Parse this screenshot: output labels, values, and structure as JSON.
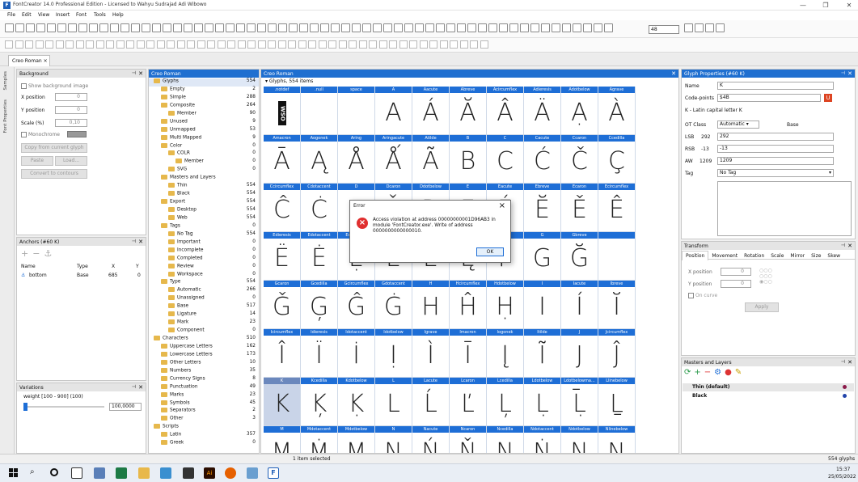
{
  "window": {
    "title": "FontCreator 14.0 Professional Edition - Licensed to Wahyu Sudrajad Adi Wibowo",
    "controls": [
      "—",
      "❐",
      "✕"
    ]
  },
  "menu": [
    "File",
    "Edit",
    "View",
    "Insert",
    "Font",
    "Tools",
    "Help"
  ],
  "toolbar": {
    "zoom_value": "48"
  },
  "doc_tab": "Creo Roman",
  "side_tabs": [
    "Samples",
    "Font Properties"
  ],
  "background_panel": {
    "title": "Background",
    "show_image_label": "Show background image",
    "x_label": "X position",
    "x_value": "0",
    "y_label": "Y position",
    "y_value": "0",
    "scale_label": "Scale (%)",
    "scale_value": "0,10",
    "mono_label": "Monochrome",
    "copy_btn": "Copy from current glyph",
    "paste_btn": "Paste",
    "load_btn": "Load...",
    "convert_btn": "Convert to contours"
  },
  "anchors_panel": {
    "title": "Anchors (#60 K)",
    "cols": [
      "Name",
      "Type",
      "X",
      "Y"
    ],
    "rows": [
      {
        "name": "bottom",
        "type": "Base",
        "x": "685",
        "y": "0"
      }
    ]
  },
  "variations_panel": {
    "title": "Variations",
    "weight_label": "weight [100 - 900] (100)",
    "weight_value": "100,0000"
  },
  "glyph_tree_panel": {
    "title": "Creo Roman",
    "rows": [
      {
        "indent": 0,
        "label": "Glyphs",
        "count": "554",
        "sel": true
      },
      {
        "indent": 1,
        "label": "Empty",
        "count": "2"
      },
      {
        "indent": 1,
        "label": "Simple",
        "count": "288"
      },
      {
        "indent": 1,
        "label": "Composite",
        "count": "264"
      },
      {
        "indent": 2,
        "label": "Member",
        "count": "90"
      },
      {
        "indent": 1,
        "label": "Unused",
        "count": "9"
      },
      {
        "indent": 1,
        "label": "Unmapped",
        "count": "53"
      },
      {
        "indent": 1,
        "label": "Multi Mapped",
        "count": "9"
      },
      {
        "indent": 1,
        "label": "Color",
        "count": "0"
      },
      {
        "indent": 2,
        "label": "COLR",
        "count": "0"
      },
      {
        "indent": 3,
        "label": "Member",
        "count": "0"
      },
      {
        "indent": 2,
        "label": "SVG",
        "count": "0"
      },
      {
        "indent": 1,
        "label": "Masters and Layers",
        "count": ""
      },
      {
        "indent": 2,
        "label": "Thin",
        "count": "554"
      },
      {
        "indent": 2,
        "label": "Black",
        "count": "554"
      },
      {
        "indent": 1,
        "label": "Export",
        "count": "554"
      },
      {
        "indent": 2,
        "label": "Desktop",
        "count": "554"
      },
      {
        "indent": 2,
        "label": "Web",
        "count": "554"
      },
      {
        "indent": 1,
        "label": "Tags",
        "count": "0"
      },
      {
        "indent": 2,
        "label": "No Tag",
        "count": "554"
      },
      {
        "indent": 2,
        "label": "Important",
        "count": "0"
      },
      {
        "indent": 2,
        "label": "Incomplete",
        "count": "0"
      },
      {
        "indent": 2,
        "label": "Completed",
        "count": "0"
      },
      {
        "indent": 2,
        "label": "Review",
        "count": "0"
      },
      {
        "indent": 2,
        "label": "Workspace",
        "count": "0"
      },
      {
        "indent": 1,
        "label": "Type",
        "count": "554"
      },
      {
        "indent": 2,
        "label": "Automatic",
        "count": "266"
      },
      {
        "indent": 2,
        "label": "Unassigned",
        "count": "0"
      },
      {
        "indent": 2,
        "label": "Base",
        "count": "517"
      },
      {
        "indent": 2,
        "label": "Ligature",
        "count": "14"
      },
      {
        "indent": 2,
        "label": "Mark",
        "count": "23"
      },
      {
        "indent": 2,
        "label": "Component",
        "count": "0"
      },
      {
        "indent": 0,
        "label": "Characters",
        "count": "510"
      },
      {
        "indent": 1,
        "label": "Uppercase Letters",
        "count": "162"
      },
      {
        "indent": 1,
        "label": "Lowercase Letters",
        "count": "173"
      },
      {
        "indent": 1,
        "label": "Other Letters",
        "count": "10"
      },
      {
        "indent": 1,
        "label": "Numbers",
        "count": "35"
      },
      {
        "indent": 1,
        "label": "Currency Signs",
        "count": "8"
      },
      {
        "indent": 1,
        "label": "Punctuation",
        "count": "49"
      },
      {
        "indent": 1,
        "label": "Marks",
        "count": "23"
      },
      {
        "indent": 1,
        "label": "Symbols",
        "count": "45"
      },
      {
        "indent": 1,
        "label": "Separators",
        "count": "2"
      },
      {
        "indent": 1,
        "label": "Other",
        "count": "3"
      },
      {
        "indent": 0,
        "label": "Scripts",
        "count": ""
      },
      {
        "indent": 1,
        "label": "Latin",
        "count": "357"
      },
      {
        "indent": 1,
        "label": "Greek",
        "count": "0"
      }
    ]
  },
  "glyph_grid": {
    "header": "Glyphs, 554 items",
    "rows": [
      [
        {
          "n": ".notdef",
          "g": "WSO"
        },
        {
          "n": ".null",
          "g": ""
        },
        {
          "n": "space",
          "g": ""
        },
        {
          "n": "A",
          "g": "A"
        },
        {
          "n": "Aacute",
          "g": "Á"
        },
        {
          "n": "Abreve",
          "g": "Ă"
        },
        {
          "n": "Acircumflex",
          "g": "Â"
        },
        {
          "n": "Adieresis",
          "g": "Ä"
        },
        {
          "n": "Adotbelow",
          "g": "Ạ"
        },
        {
          "n": "Agrave",
          "g": "À"
        }
      ],
      [
        {
          "n": "Amacron",
          "g": "Ā"
        },
        {
          "n": "Aogonek",
          "g": "Ą"
        },
        {
          "n": "Aring",
          "g": "Å"
        },
        {
          "n": "Aringacute",
          "g": "Ǻ"
        },
        {
          "n": "Atilde",
          "g": "Ã"
        },
        {
          "n": "B",
          "g": "B"
        },
        {
          "n": "C",
          "g": "C"
        },
        {
          "n": "Cacute",
          "g": "Ć"
        },
        {
          "n": "Ccaron",
          "g": "Č"
        },
        {
          "n": "Ccedilla",
          "g": "Ç"
        }
      ],
      [
        {
          "n": "Ccircumflex",
          "g": "Ĉ"
        },
        {
          "n": "Cdotaccent",
          "g": "Ċ"
        },
        {
          "n": "D",
          "g": "D"
        },
        {
          "n": "Dcaron",
          "g": "Ď"
        },
        {
          "n": "Ddotbelow",
          "g": "Ḍ"
        },
        {
          "n": "E",
          "g": "E"
        },
        {
          "n": "Eacute",
          "g": "É"
        },
        {
          "n": "Ebreve",
          "g": "Ĕ"
        },
        {
          "n": "Ecaron",
          "g": "Ě"
        },
        {
          "n": "Ecircumflex",
          "g": "Ê"
        }
      ],
      [
        {
          "n": "Edieresis",
          "g": "Ë"
        },
        {
          "n": "Edotaccent",
          "g": "Ė"
        },
        {
          "n": "Edotbelow",
          "g": "Ẹ"
        },
        {
          "n": "Egrave",
          "g": "È"
        },
        {
          "n": "Emacron",
          "g": "Ē"
        },
        {
          "n": "Eogonek",
          "g": "Ę"
        },
        {
          "n": "F",
          "g": "F"
        },
        {
          "n": "G",
          "g": "G"
        },
        {
          "n": "Gbreve",
          "g": "Ğ"
        },
        {
          "n": "",
          "g": ""
        }
      ],
      [
        {
          "n": "Gcaron",
          "g": "Ǧ"
        },
        {
          "n": "Gcedilla",
          "g": "Ģ"
        },
        {
          "n": "Gcircumflex",
          "g": "Ĝ"
        },
        {
          "n": "Gdotaccent",
          "g": "Ġ"
        },
        {
          "n": "H",
          "g": "H"
        },
        {
          "n": "Hcircumflex",
          "g": "Ĥ"
        },
        {
          "n": "Hdotbelow",
          "g": "Ḥ"
        },
        {
          "n": "I",
          "g": "I"
        },
        {
          "n": "Iacute",
          "g": "Í"
        },
        {
          "n": "Ibreve",
          "g": "Ĭ"
        }
      ],
      [
        {
          "n": "Icircumflex",
          "g": "Î"
        },
        {
          "n": "Idieresis",
          "g": "Ï"
        },
        {
          "n": "Idotaccent",
          "g": "İ"
        },
        {
          "n": "Idotbelow",
          "g": "Ị"
        },
        {
          "n": "Igrave",
          "g": "Ì"
        },
        {
          "n": "Imacron",
          "g": "Ī"
        },
        {
          "n": "Iogonek",
          "g": "Į"
        },
        {
          "n": "Itilde",
          "g": "Ĩ"
        },
        {
          "n": "J",
          "g": "J"
        },
        {
          "n": "Jcircumflex",
          "g": "Ĵ"
        }
      ],
      [
        {
          "n": "K",
          "g": "K",
          "sel": true
        },
        {
          "n": "Kcedilla",
          "g": "Ķ"
        },
        {
          "n": "Kdotbelow",
          "g": "Ḳ"
        },
        {
          "n": "L",
          "g": "L"
        },
        {
          "n": "Lacute",
          "g": "Ĺ"
        },
        {
          "n": "Lcaron",
          "g": "Ľ"
        },
        {
          "n": "Lcedilla",
          "g": "Ļ"
        },
        {
          "n": "Ldotbelow",
          "g": "Ḷ"
        },
        {
          "n": "Ldotbelowma...",
          "g": "Ḹ"
        },
        {
          "n": "Llinebelow",
          "g": "Ḻ"
        }
      ],
      [
        {
          "n": "M",
          "g": "M"
        },
        {
          "n": "Mdotaccent",
          "g": "Ṁ"
        },
        {
          "n": "Mdotbelow",
          "g": "Ṃ"
        },
        {
          "n": "N",
          "g": "N"
        },
        {
          "n": "Nacute",
          "g": "Ń"
        },
        {
          "n": "Ncaron",
          "g": "Ň"
        },
        {
          "n": "Ncedilla",
          "g": "Ņ"
        },
        {
          "n": "Ndotaccent",
          "g": "Ṅ"
        },
        {
          "n": "Ndotbelow",
          "g": "Ṇ"
        },
        {
          "n": "Nlinebelow",
          "g": "Ṉ"
        }
      ]
    ]
  },
  "error_dialog": {
    "title": "Error",
    "message": "Access violation at address 00000000001D96AB3 in module 'FontCreator.exe'. Write of address 0000000000000010.",
    "ok": "OK"
  },
  "glyph_properties": {
    "title": "Glyph Properties (#60 K)",
    "name_label": "Name",
    "name_value": "K",
    "codepoints_label": "Code-points",
    "codepoints_value": "$4B",
    "desc": "K - Latin capital letter K",
    "otclass_label": "OT Class",
    "otclass_value": "Automatic",
    "otclass_detected": "Base",
    "lsb_label": "LSB",
    "lsb_num": "292",
    "lsb_value": "292",
    "rsb_label": "RSB",
    "rsb_num": "-13",
    "rsb_value": "-13",
    "aw_label": "AW",
    "aw_num": "1209",
    "aw_value": "1209",
    "tag_label": "Tag",
    "tag_value": "No Tag"
  },
  "transform_panel": {
    "title": "Transform",
    "tabs": [
      "Position",
      "Movement",
      "Rotation",
      "Scale",
      "Mirror",
      "Size",
      "Skew"
    ],
    "x_label": "X position",
    "x_value": "0",
    "y_label": "Y position",
    "y_value": "0",
    "oncurve_label": "On curve",
    "apply": "Apply"
  },
  "masters_panel": {
    "title": "Masters and Layers",
    "rows": [
      "Thin (default)",
      "Black"
    ]
  },
  "status": {
    "left": "1 item selected",
    "right": "554 glyphs"
  },
  "taskbar": {
    "time": "15:37",
    "date": "25/05/2022"
  }
}
